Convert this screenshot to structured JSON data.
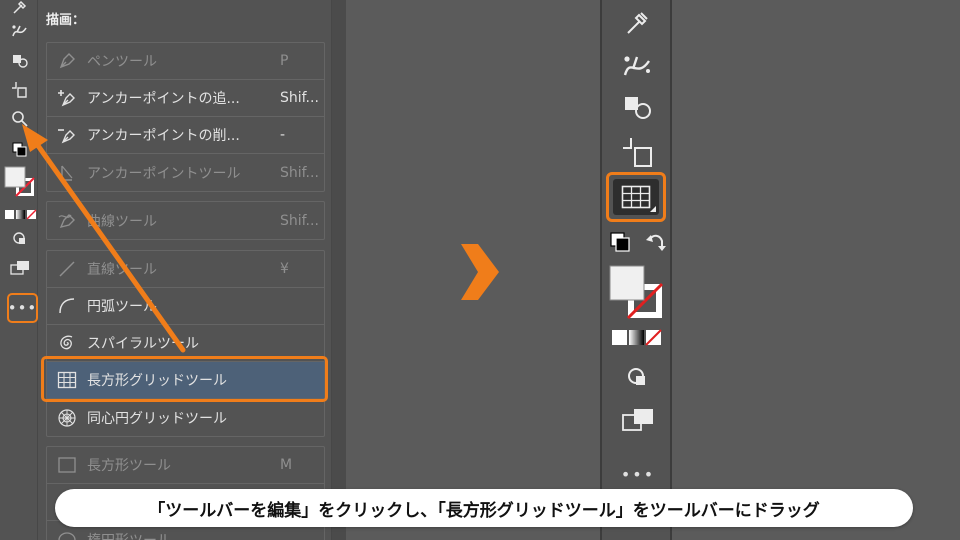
{
  "flyout": {
    "section_title": "描画：",
    "groups": [
      {
        "tools": [
          {
            "label": "ペンツール",
            "shortcut": "P",
            "icon": "pen-icon",
            "dim": true
          },
          {
            "label": "アンカーポイントの追...",
            "shortcut": "Shif...",
            "icon": "add-anchor-icon",
            "dim": false
          },
          {
            "label": "アンカーポイントの削...",
            "shortcut": "-",
            "icon": "delete-anchor-icon",
            "dim": false
          },
          {
            "label": "アンカーポイントツール",
            "shortcut": "Shif...",
            "icon": "anchor-point-icon",
            "dim": true
          }
        ]
      },
      {
        "tools": [
          {
            "label": "曲線ツール",
            "shortcut": "Shif...",
            "icon": "curvature-icon",
            "dim": true
          }
        ]
      },
      {
        "tools": [
          {
            "label": "直線ツール",
            "shortcut": "¥",
            "icon": "line-segment-icon",
            "dim": true
          },
          {
            "label": "円弧ツール",
            "shortcut": "",
            "icon": "arc-icon",
            "dim": false
          },
          {
            "label": "スパイラルツール",
            "shortcut": "",
            "icon": "spiral-icon",
            "dim": false
          },
          {
            "label": "長方形グリッドツール",
            "shortcut": "",
            "icon": "rectangular-grid-icon",
            "dim": false,
            "selected": true
          },
          {
            "label": "同心円グリッドツール",
            "shortcut": "",
            "icon": "polar-grid-icon",
            "dim": false
          }
        ]
      },
      {
        "tools": [
          {
            "label": "長方形ツール",
            "shortcut": "M",
            "icon": "rectangle-icon",
            "dim": true
          },
          {
            "label": "",
            "shortcut": "",
            "icon": "rounded-rectangle-icon",
            "dim": true
          },
          {
            "label": "楕円形ツール",
            "shortcut": "",
            "icon": "ellipse-icon",
            "dim": true
          }
        ]
      }
    ]
  },
  "left_toolbar": {
    "more_label": "•••",
    "icons": [
      "eyedropper-icon",
      "puppet-warp-icon",
      "shape-builder-icon",
      "artboard-icon",
      "zoom-icon",
      "default-colors-icon",
      "fill-stroke-icon",
      "color-mode-icon",
      "draw-mode-icon",
      "screen-mode-icon"
    ]
  },
  "right_toolbar": {
    "more_label": "•••",
    "icons": [
      "eyedropper-icon",
      "puppet-warp-icon",
      "shape-builder-icon",
      "artboard-icon",
      "rectangular-grid-icon",
      "default-colors-icon",
      "swap-colors-icon",
      "fill-stroke-icon",
      "color-mode-icon",
      "draw-mode-icon",
      "screen-mode-icon"
    ]
  },
  "colors": {
    "accent_orange": "#f07d1a",
    "selected_row": "#4d6178",
    "panel_bg": "#535353",
    "canvas_bg": "#5b5b5b"
  },
  "caption": "「ツールバーを編集」をクリックし、「長方形グリッドツール」をツールバーにドラッグ"
}
